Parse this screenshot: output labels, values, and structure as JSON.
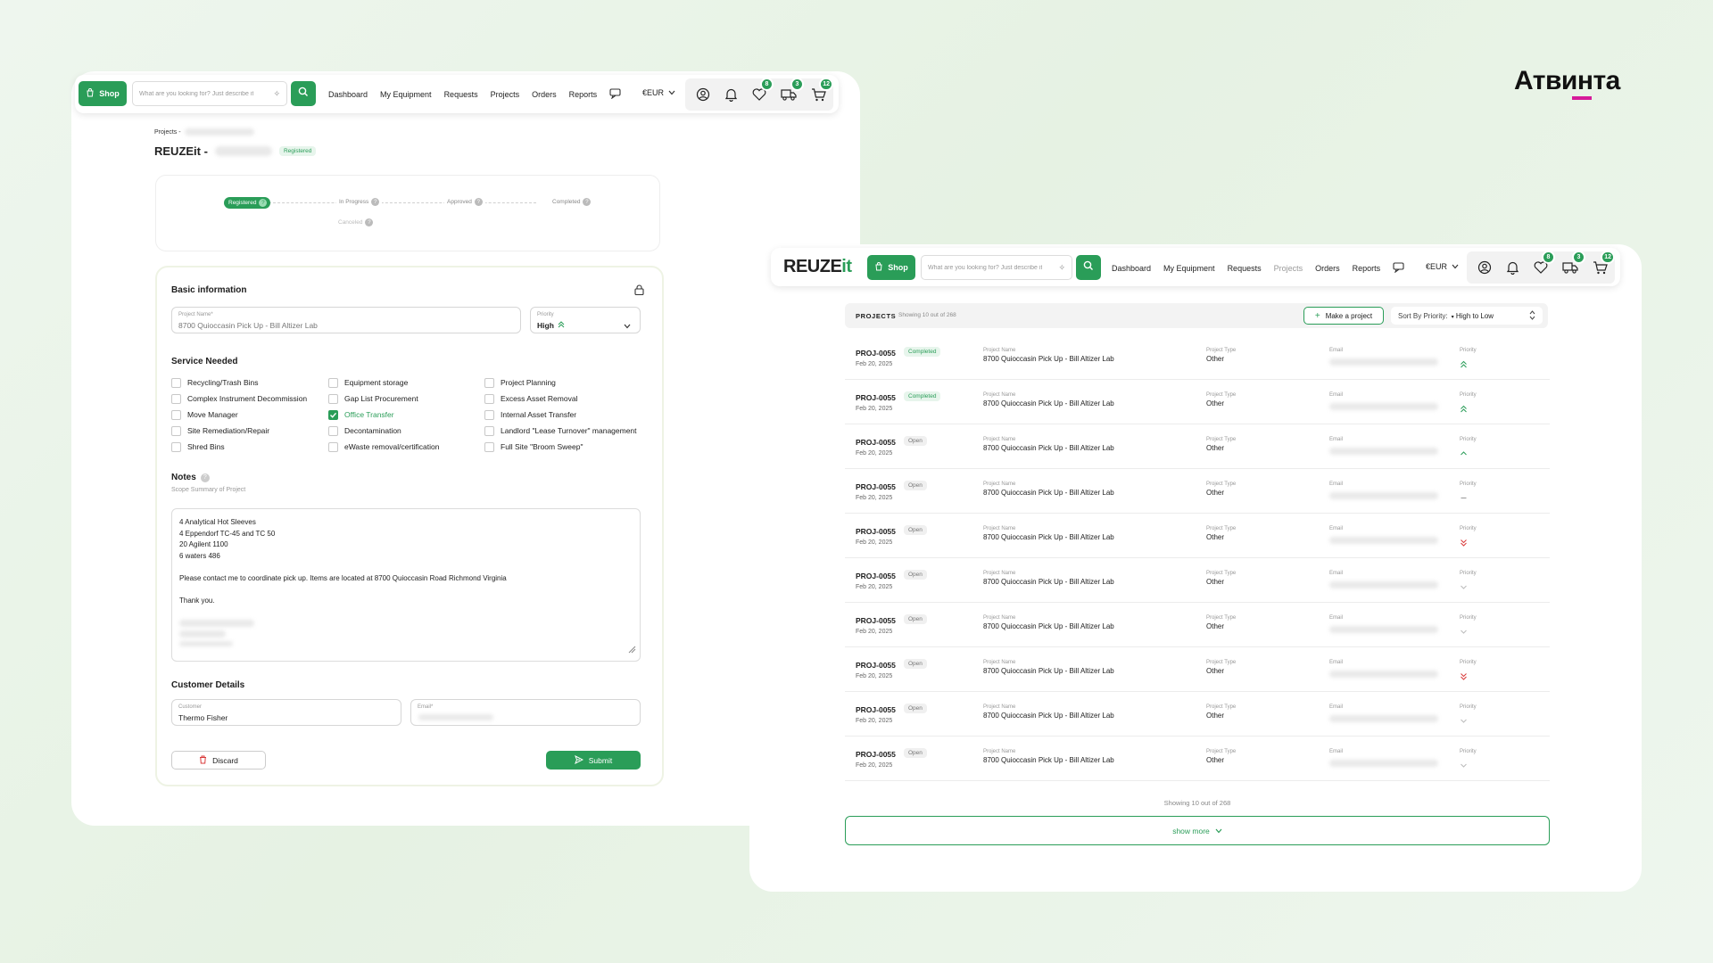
{
  "brand_logo": "Атвинта",
  "brand_accent": "#d61b9a",
  "accent_color": "#2a9d58",
  "left_window": {
    "nav": {
      "shop_label": "Shop",
      "search_placeholder": "What are you looking for? Just describe it",
      "links": [
        "Dashboard",
        "My Equipment",
        "Requests",
        "Projects",
        "Orders",
        "Reports"
      ],
      "currency": "€EUR",
      "badges": {
        "wishlist": "8",
        "delivery": "3",
        "cart": "12"
      }
    },
    "breadcrumb": "Projects -",
    "title": "REUZEit -",
    "title_badge": "Registered",
    "stepper": {
      "steps": [
        "Registered",
        "In Progress",
        "Approved",
        "Completed"
      ],
      "sub_step": "Canceled",
      "active": "Registered"
    },
    "basic_info": {
      "heading": "Basic information",
      "project_name_label": "Project Name*",
      "project_name_value": "8700 Quioccasin Pick Up - Bill Altizer Lab",
      "priority_label": "Priority",
      "priority_value": "High"
    },
    "service": {
      "heading": "Service Needed",
      "columns": [
        [
          {
            "label": "Recycling/Trash Bins",
            "checked": false
          },
          {
            "label": "Complex Instrument Decommission",
            "checked": false
          },
          {
            "label": "Move Manager",
            "checked": false
          },
          {
            "label": "Site Remediation/Repair",
            "checked": false
          },
          {
            "label": "Shred Bins",
            "checked": false
          }
        ],
        [
          {
            "label": "Equipment storage",
            "checked": false
          },
          {
            "label": "Gap List Procurement",
            "checked": false
          },
          {
            "label": "Office Transfer",
            "checked": true
          },
          {
            "label": "Decontamination",
            "checked": false
          },
          {
            "label": "eWaste removal/certification",
            "checked": false
          }
        ],
        [
          {
            "label": "Project Planning",
            "checked": false
          },
          {
            "label": "Excess Asset Removal",
            "checked": false
          },
          {
            "label": "Internal Asset Transfer",
            "checked": false
          },
          {
            "label": "Landlord \"Lease Turnover\" management",
            "checked": false
          },
          {
            "label": "Full Site \"Broom Sweep\"",
            "checked": false
          }
        ]
      ]
    },
    "notes": {
      "heading": "Notes",
      "subheading": "Scope Summary of Project",
      "lines": [
        "4 Analytical Hot Sleeves",
        "4 Eppendorf TC-45 and TC 50",
        "20 Agilent 1100",
        "6 waters 486",
        "",
        "Please contact me to coordinate pick up.  Items are located at 8700 Quioccasin Road Richmond Virginia",
        "",
        "Thank you."
      ]
    },
    "customer": {
      "heading": "Customer Details",
      "customer_label": "Customer",
      "customer_value": "Thermo Fisher",
      "email_label": "Email*"
    },
    "discard_label": "Discard",
    "submit_label": "Submit"
  },
  "right_window": {
    "logo_main": "REUZE",
    "logo_accent": "it",
    "nav": {
      "shop_label": "Shop",
      "search_placeholder": "What are you looking for? Just describe it",
      "links": [
        "Dashboard",
        "My Equipment",
        "Requests",
        "Projects",
        "Orders",
        "Reports"
      ],
      "active_link": "Projects",
      "currency": "€EUR",
      "badges": {
        "wishlist": "8",
        "delivery": "3",
        "cart": "12"
      }
    },
    "toolbar": {
      "title": "PROJECTS",
      "count_text": "Showing 10 out of 268",
      "make_project_label": "Make a project",
      "sort_label": "Sort By Priority:",
      "sort_value": "High to Low"
    },
    "column_labels": {
      "project_name": "Project Name",
      "project_type": "Project Type",
      "email": "Email",
      "priority": "Priority"
    },
    "rows": [
      {
        "id": "PROJ-0055",
        "status": "Completed",
        "date": "Feb 20, 2025",
        "project_name": "8700 Quioccasin Pick Up - Bill Altizer Lab",
        "project_type": "Other",
        "priority": "high"
      },
      {
        "id": "PROJ-0055",
        "status": "Completed",
        "date": "Feb 20, 2025",
        "project_name": "8700 Quioccasin Pick Up - Bill Altizer Lab",
        "project_type": "Other",
        "priority": "high"
      },
      {
        "id": "PROJ-0055",
        "status": "Open",
        "date": "Feb 20, 2025",
        "project_name": "8700 Quioccasin Pick Up - Bill Altizer Lab",
        "project_type": "Other",
        "priority": "medium"
      },
      {
        "id": "PROJ-0055",
        "status": "Open",
        "date": "Feb 20, 2025",
        "project_name": "8700 Quioccasin Pick Up - Bill Altizer Lab",
        "project_type": "Other",
        "priority": "normal"
      },
      {
        "id": "PROJ-0055",
        "status": "Open",
        "date": "Feb 20, 2025",
        "project_name": "8700 Quioccasin Pick Up - Bill Altizer Lab",
        "project_type": "Other",
        "priority": "urgent-low"
      },
      {
        "id": "PROJ-0055",
        "status": "Open",
        "date": "Feb 20, 2025",
        "project_name": "8700 Quioccasin Pick Up - Bill Altizer Lab",
        "project_type": "Other",
        "priority": "low"
      },
      {
        "id": "PROJ-0055",
        "status": "Open",
        "date": "Feb 20, 2025",
        "project_name": "8700 Quioccasin Pick Up - Bill Altizer Lab",
        "project_type": "Other",
        "priority": "low"
      },
      {
        "id": "PROJ-0055",
        "status": "Open",
        "date": "Feb 20, 2025",
        "project_name": "8700 Quioccasin Pick Up - Bill Altizer Lab",
        "project_type": "Other",
        "priority": "urgent-low"
      },
      {
        "id": "PROJ-0055",
        "status": "Open",
        "date": "Feb 20, 2025",
        "project_name": "8700 Quioccasin Pick Up - Bill Altizer Lab",
        "project_type": "Other",
        "priority": "low"
      },
      {
        "id": "PROJ-0055",
        "status": "Open",
        "date": "Feb 20, 2025",
        "project_name": "8700 Quioccasin Pick Up - Bill Altizer Lab",
        "project_type": "Other",
        "priority": "low"
      }
    ],
    "footer_count": "Showing 10 out of 268",
    "show_more_label": "show more"
  }
}
